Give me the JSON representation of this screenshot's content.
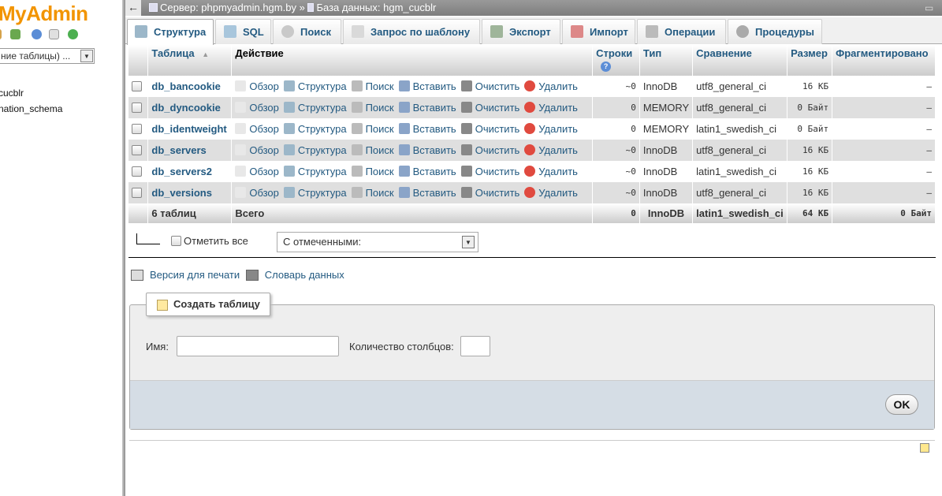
{
  "nav": {
    "logo": "MyAdmin",
    "table_select": "ние таблицы) ...",
    "databases": [
      "cucblr",
      "nation_schema"
    ]
  },
  "topbar": {
    "server_label": "Сервер: phpmyadmin.hgm.by",
    "separator": "»",
    "db_label": "База данных: hgm_cucblr"
  },
  "tabs": [
    {
      "label": "Структура",
      "icon": "structure-icon"
    },
    {
      "label": "SQL",
      "icon": "sql-icon"
    },
    {
      "label": "Поиск",
      "icon": "search-icon"
    },
    {
      "label": "Запрос по шаблону",
      "icon": "query-icon"
    },
    {
      "label": "Экспорт",
      "icon": "export-icon"
    },
    {
      "label": "Импорт",
      "icon": "import-icon"
    },
    {
      "label": "Операции",
      "icon": "wrench-icon"
    },
    {
      "label": "Процедуры",
      "icon": "routines-icon"
    }
  ],
  "table": {
    "headers": {
      "table": "Таблица",
      "action": "Действие",
      "rows": "Строки",
      "type": "Тип",
      "collation": "Сравнение",
      "size": "Размер",
      "overhead": "Фрагментировано"
    },
    "actions": {
      "browse": "Обзор",
      "structure": "Структура",
      "search": "Поиск",
      "insert": "Вставить",
      "empty": "Очистить",
      "drop": "Удалить"
    },
    "rows": [
      {
        "name": "db_bancookie",
        "rows": "~0",
        "type": "InnoDB",
        "collation": "utf8_general_ci",
        "size": "16 КБ",
        "overhead": "–"
      },
      {
        "name": "db_dyncookie",
        "rows": "0",
        "type": "MEMORY",
        "collation": "utf8_general_ci",
        "size": "0 Байт",
        "overhead": "–"
      },
      {
        "name": "db_identweight",
        "rows": "0",
        "type": "MEMORY",
        "collation": "latin1_swedish_ci",
        "size": "0 Байт",
        "overhead": "–"
      },
      {
        "name": "db_servers",
        "rows": "~0",
        "type": "InnoDB",
        "collation": "utf8_general_ci",
        "size": "16 КБ",
        "overhead": "–"
      },
      {
        "name": "db_servers2",
        "rows": "~0",
        "type": "InnoDB",
        "collation": "latin1_swedish_ci",
        "size": "16 КБ",
        "overhead": "–"
      },
      {
        "name": "db_versions",
        "rows": "~0",
        "type": "InnoDB",
        "collation": "utf8_general_ci",
        "size": "16 КБ",
        "overhead": "–"
      }
    ],
    "footer": {
      "count": "6 таблиц",
      "total": "Всего",
      "rows": "0",
      "type": "InnoDB",
      "collation": "latin1_swedish_ci",
      "size": "64 КБ",
      "overhead": "0 Байт"
    }
  },
  "bulk": {
    "check_all": "Отметить все",
    "with_selected": "С отмеченными:"
  },
  "links": {
    "print": "Версия для печати",
    "dictionary": "Словарь данных"
  },
  "create": {
    "legend": "Создать таблицу",
    "name_label": "Имя:",
    "name_value": "",
    "columns_label": "Количество столбцов:",
    "columns_value": "",
    "ok": "OK"
  }
}
